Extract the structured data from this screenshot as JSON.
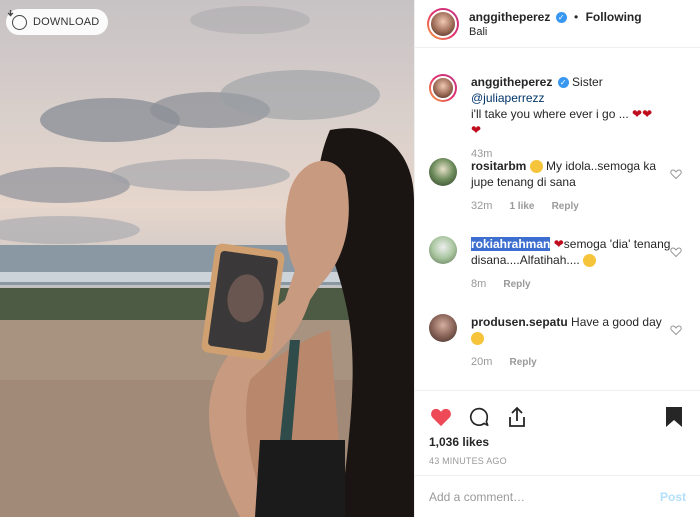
{
  "photo": {
    "download_label": "DOWNLOAD"
  },
  "header": {
    "username": "anggitheperez",
    "separator": "•",
    "follow_status": "Following",
    "location": "Bali"
  },
  "caption": {
    "username": "anggitheperez",
    "text_before": "Sister ",
    "mention": "@juliaperrezz",
    "text_line2": "i'll take you where ever i go ...",
    "hearts": "❤❤",
    "hearts_line3": "❤",
    "time": "43m"
  },
  "comments": [
    {
      "username": "rositarbm",
      "text": "My idola..semoga ka jupe tenang di sana",
      "time": "32m",
      "likes": "1 like",
      "reply": "Reply"
    },
    {
      "username": "rokiahrahman",
      "text_a": "semoga 'dia' tenang disana....Alfatihah....",
      "time": "8m",
      "reply": "Reply"
    },
    {
      "username": "produsen.sepatu",
      "text": "Have a good day",
      "time": "20m",
      "reply": "Reply"
    }
  ],
  "actions": {
    "likes_count": "1,036 likes",
    "posted_ago": "43 MINUTES AGO"
  },
  "add_comment": {
    "placeholder": "Add a comment…",
    "post_label": "Post"
  },
  "colors": {
    "heart_red": "#ed4956",
    "link_blue": "#003569",
    "verified_blue": "#3897f0"
  }
}
